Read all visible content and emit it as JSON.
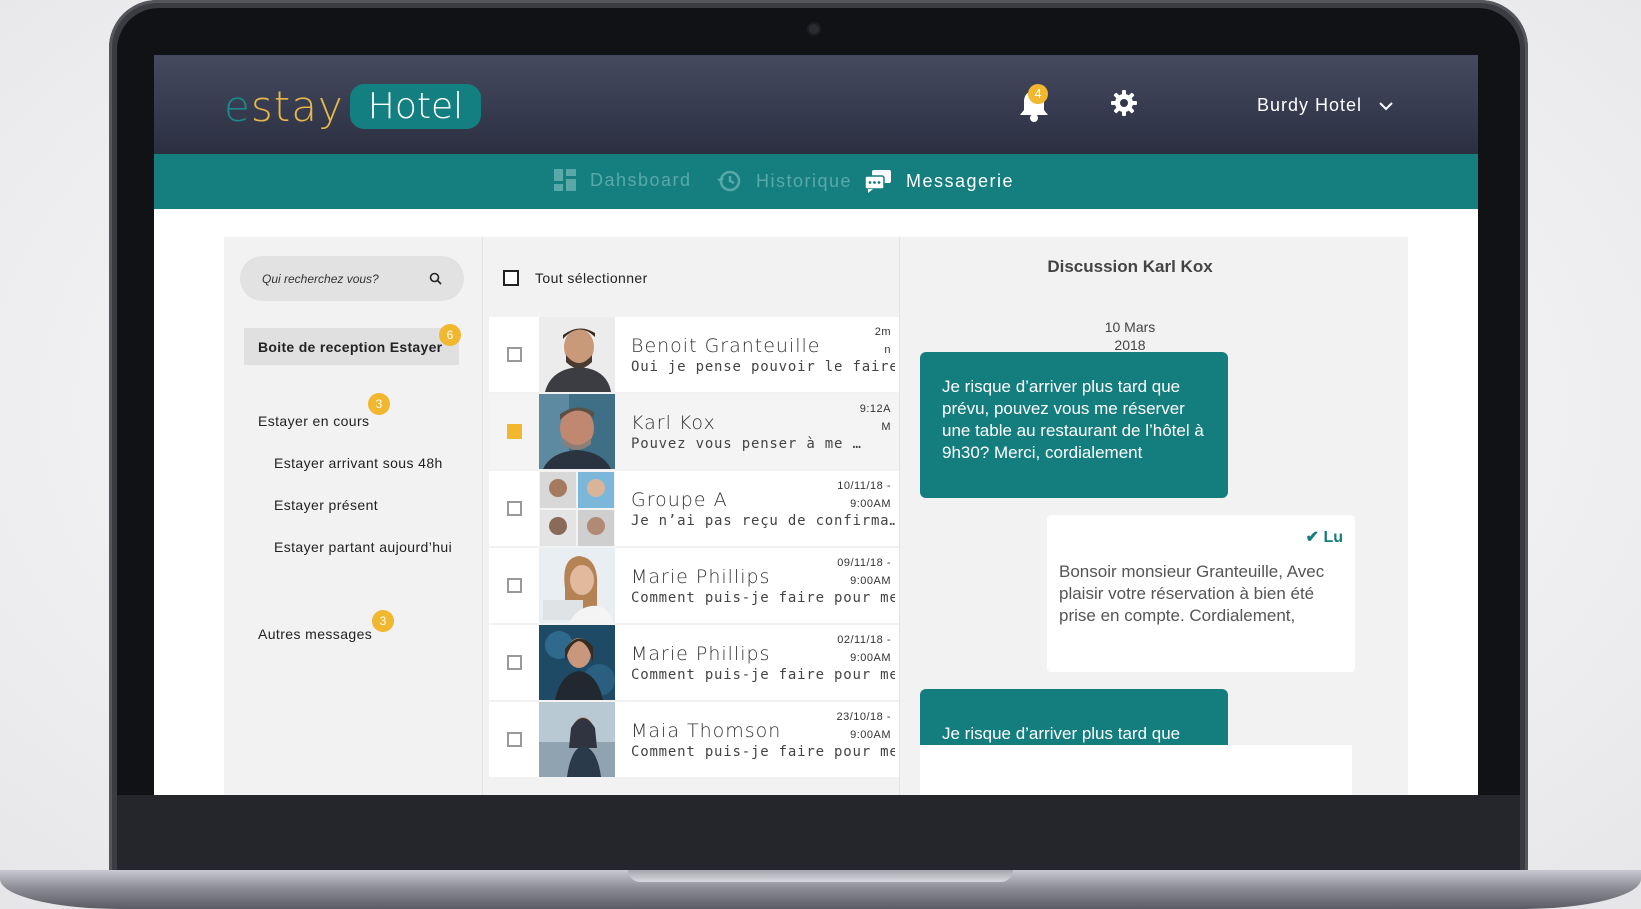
{
  "header": {
    "logo_part1_e": "e",
    "logo_part1_rest": "stay",
    "logo_part2": "Hotel",
    "notification_count": "4",
    "hotel_name": "Burdy Hotel"
  },
  "nav": {
    "items": [
      {
        "label": "Dahsboard",
        "icon": "dashboard-icon",
        "active": false
      },
      {
        "label": "Historique",
        "icon": "history-icon",
        "active": false
      },
      {
        "label": "Messagerie",
        "icon": "chat-icon",
        "active": true
      }
    ]
  },
  "sidebar": {
    "search_placeholder": "Qui recherchez vous?",
    "inbox_label": "Boite de reception Estayer",
    "inbox_count": "6",
    "current_label": "Estayer en cours",
    "current_count": "3",
    "sub_items": [
      "Estayer arrivant sous 48h",
      "Estayer présent",
      "Estayer partant aujourd’hui"
    ],
    "others_label": "Autres messages",
    "others_count": "3"
  },
  "list": {
    "select_all_label": "Tout sélectionner",
    "rows": [
      {
        "name": "Benoit Granteuille",
        "preview": "Oui je pense pouvoir le faire mer…",
        "time_line1": "2m",
        "time_line2": "n",
        "checked": false
      },
      {
        "name": "Karl Kox",
        "preview": "Pouvez vous penser à me …",
        "time_line1": "9:12A",
        "time_line2": "M",
        "checked": true
      },
      {
        "name": "Groupe A",
        "preview": "Je n’ai pas reçu de confirma…",
        "time_line1": "10/11/18 -",
        "time_line2": "9:00AM",
        "checked": false
      },
      {
        "name": "Marie Phillips",
        "preview": "Comment puis-je faire pour me re…",
        "time_line1": "09/11/18 -",
        "time_line2": "9:00AM",
        "checked": false
      },
      {
        "name": "Marie Phillips",
        "preview": "Comment puis-je faire pour me re…",
        "time_line1": "02/11/18 -",
        "time_line2": "9:00AM",
        "checked": false
      },
      {
        "name": "Maia Thomson",
        "preview": "Comment puis-je faire pour me re…",
        "time_line1": "23/10/18 -",
        "time_line2": "9:00AM",
        "checked": false
      }
    ]
  },
  "chat": {
    "title": "Discussion  Karl Kox",
    "date_line1": "10 Mars",
    "date_line2": "2018",
    "incoming_1": "Je risque d’arriver plus tard que prévu, pouvez vous me réserver une table au restaurant de l’hôtel à 9h30? Merci, cordialement",
    "read_label": "Lu",
    "outgoing_1": "Bonsoir monsieur Granteuille, Avec plaisir votre réservation à bien été prise en compte. Cordialement,",
    "incoming_2": "Je risque d’arriver plus tard que"
  },
  "colors": {
    "teal": "#157f80",
    "accent_yellow": "#f0b72f",
    "header_dark": "#2b2f41"
  }
}
